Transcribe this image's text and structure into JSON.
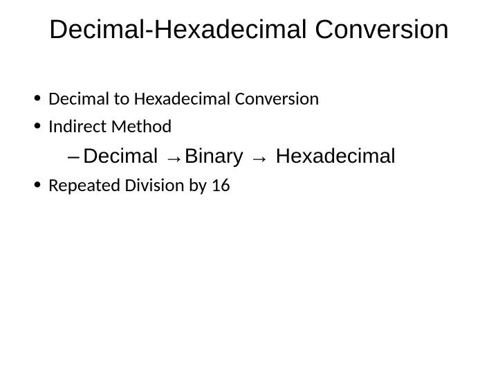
{
  "title": "Decimal-Hexadecimal Conversion",
  "bullets": {
    "b0": "Decimal to Hexadecimal Conversion",
    "b1": "Indirect Method",
    "b1_sub0": "Decimal →Binary → Hexadecimal",
    "b2": "Repeated Division by 16"
  }
}
